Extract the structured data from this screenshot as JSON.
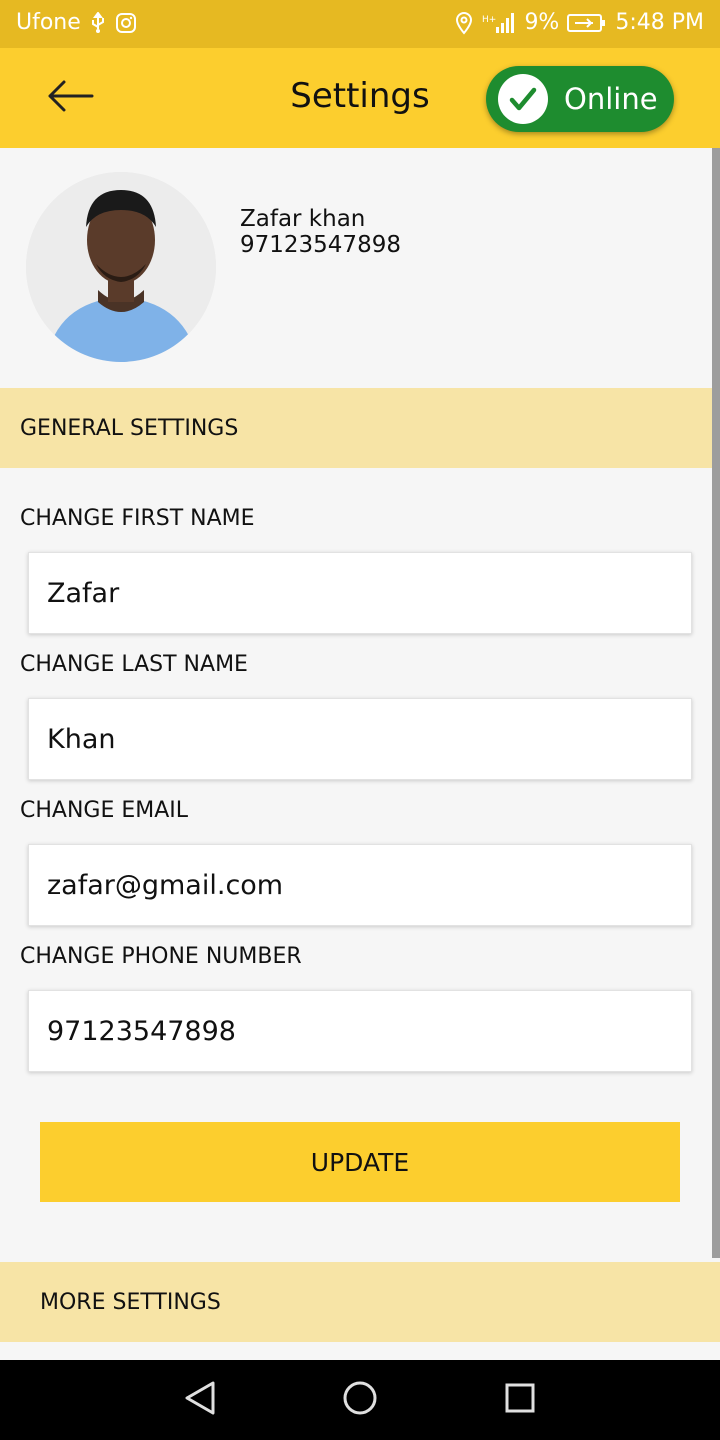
{
  "status_bar": {
    "carrier": "Ufone",
    "battery": "9%",
    "time": "5:48 PM",
    "icons": [
      "usb-icon",
      "instagram-icon",
      "location-icon",
      "signal-icon",
      "battery-icon"
    ]
  },
  "app_bar": {
    "title": "Settings",
    "online_label": "Online",
    "back_icon": "back-arrow-icon"
  },
  "profile": {
    "name": "Zafar khan",
    "phone": "97123547898"
  },
  "general_settings": {
    "title": "GENERAL SETTINGS",
    "fields": {
      "first_name": {
        "label": "CHANGE FIRST NAME",
        "value": "Zafar"
      },
      "last_name": {
        "label": "CHANGE LAST NAME",
        "value": "Khan"
      },
      "email": {
        "label": "CHANGE EMAIL",
        "value": "zafar@gmail.com"
      },
      "phone": {
        "label": "CHANGE PHONE NUMBER",
        "value": "97123547898"
      }
    },
    "update_label": "UPDATE"
  },
  "more_settings": {
    "title": "MORE SETTINGS"
  },
  "colors": {
    "primary": "#fcce2e",
    "status_bar": "#e6b922",
    "section_bg": "#f7e4a6",
    "online_green": "#1e8c2f"
  }
}
